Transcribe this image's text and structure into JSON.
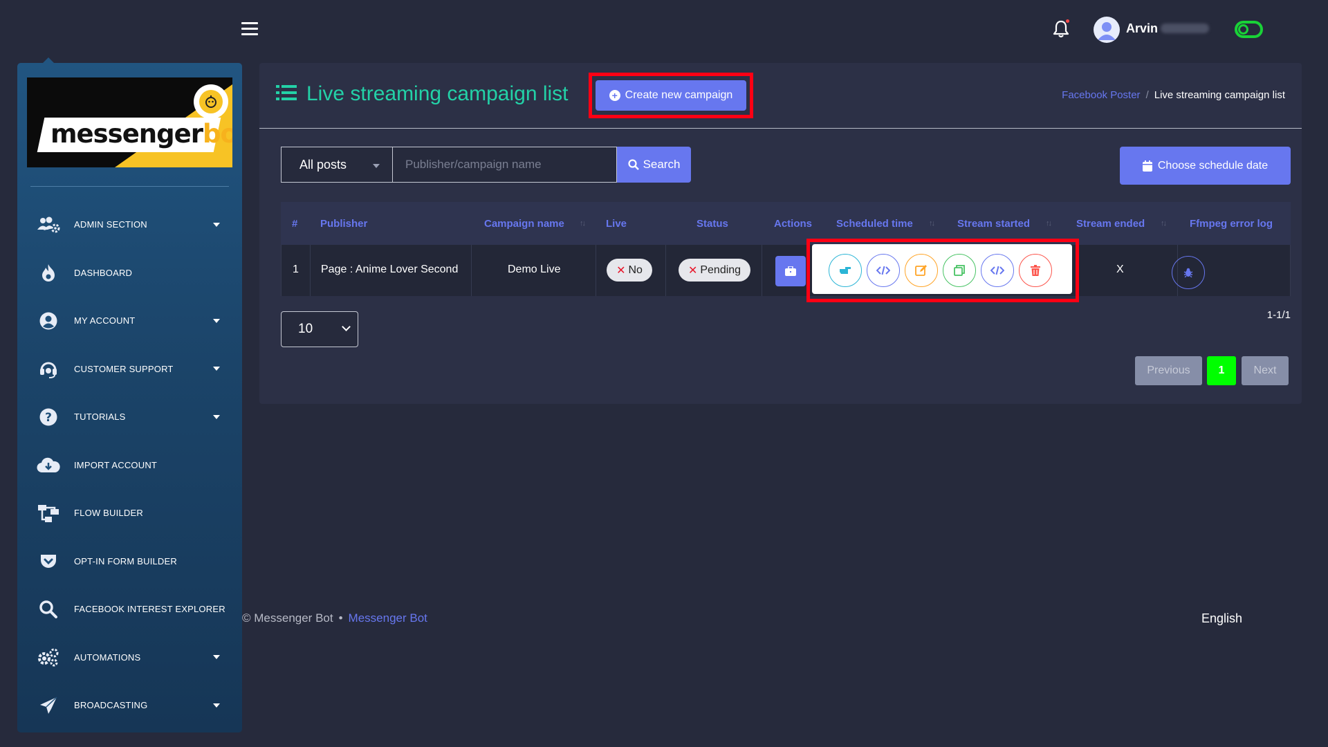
{
  "topbar": {
    "user_name": "Arvin"
  },
  "sidebar": {
    "logo": {
      "text_main": "messenger",
      "text_accent": "bot"
    },
    "items": [
      {
        "label": "ADMIN SECTION",
        "icon": "users-cog-icon",
        "has_caret": true
      },
      {
        "label": "DASHBOARD",
        "icon": "fire-icon",
        "has_caret": false
      },
      {
        "label": "MY ACCOUNT",
        "icon": "user-circle-icon",
        "has_caret": true
      },
      {
        "label": "CUSTOMER SUPPORT",
        "icon": "headset-icon",
        "has_caret": true
      },
      {
        "label": "TUTORIALS",
        "icon": "question-circle-icon",
        "has_caret": true
      },
      {
        "label": "IMPORT ACCOUNT",
        "icon": "cloud-download-icon",
        "has_caret": false
      },
      {
        "label": "FLOW BUILDER",
        "icon": "sitemap-icon",
        "has_caret": false
      },
      {
        "label": "OPT-IN FORM BUILDER",
        "icon": "pocket-icon",
        "has_caret": false
      },
      {
        "label": "FACEBOOK INTEREST EXPLORER",
        "icon": "search-icon",
        "has_caret": false
      },
      {
        "label": "AUTOMATIONS",
        "icon": "cogs-icon",
        "has_caret": true
      },
      {
        "label": "BROADCASTING",
        "icon": "paper-plane-icon",
        "has_caret": true
      }
    ]
  },
  "main": {
    "title": "Live streaming campaign list",
    "create_button": "Create new campaign",
    "breadcrumb": {
      "parent": "Facebook Poster",
      "separator": "/",
      "current": "Live streaming campaign list"
    },
    "filter": {
      "post_type": "All posts",
      "search_placeholder": "Publisher/campaign name",
      "search_button": "Search"
    },
    "schedule_button": "Choose schedule date",
    "table": {
      "headers": [
        "#",
        "Publisher",
        "Campaign name",
        "Live",
        "Status",
        "Actions",
        "Scheduled time",
        "Stream started",
        "Stream ended",
        "Ffmpeg error log"
      ],
      "rows": [
        {
          "index": "1",
          "publisher": "Page : Anime Lover Second",
          "campaign": "Demo Live",
          "live": "No",
          "status": "Pending",
          "stream_ended": "X"
        }
      ]
    },
    "page_length": "10",
    "page_info": "1-1/1",
    "pagination": {
      "previous": "Previous",
      "current": "1",
      "next": "Next"
    }
  },
  "footer": {
    "copyright": "© Messenger Bot",
    "bullet": "•",
    "link": "Messenger Bot",
    "language": "English"
  },
  "colors": {
    "accent": "#6777ef",
    "title": "#23d1a7",
    "highlight": "#ff0014",
    "toggle": "#19d237",
    "page_active": "#00ff00"
  }
}
